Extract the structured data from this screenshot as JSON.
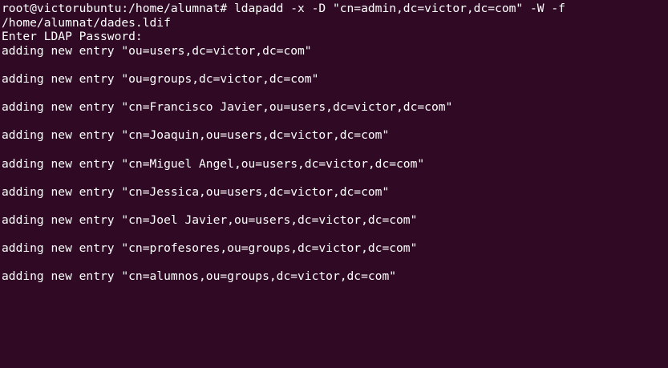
{
  "terminal": {
    "colors": {
      "background": "#300a24",
      "foreground": "#ffffff"
    },
    "lines": [
      "root@victorubuntu:/home/alumnat# ldapadd -x -D \"cn=admin,dc=victor,dc=com\" -W -f",
      "/home/alumnat/dades.ldif",
      "Enter LDAP Password:",
      "adding new entry \"ou=users,dc=victor,dc=com\"",
      "",
      "adding new entry \"ou=groups,dc=victor,dc=com\"",
      "",
      "adding new entry \"cn=Francisco Javier,ou=users,dc=victor,dc=com\"",
      "",
      "adding new entry \"cn=Joaquin,ou=users,dc=victor,dc=com\"",
      "",
      "adding new entry \"cn=Miguel Angel,ou=users,dc=victor,dc=com\"",
      "",
      "adding new entry \"cn=Jessica,ou=users,dc=victor,dc=com\"",
      "",
      "adding new entry \"cn=Joel Javier,ou=users,dc=victor,dc=com\"",
      "",
      "adding new entry \"cn=profesores,ou=groups,dc=victor,dc=com\"",
      "",
      "adding new entry \"cn=alumnos,ou=groups,dc=victor,dc=com\""
    ]
  }
}
